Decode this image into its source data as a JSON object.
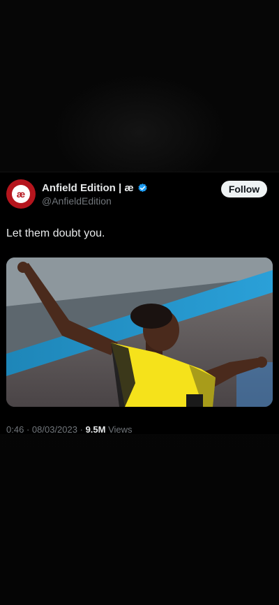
{
  "tweet": {
    "author": {
      "display_name": "Anfield Edition | æ",
      "handle": "@AnfieldEdition",
      "avatar_text": "æ",
      "verified": true,
      "avatar_color": "#b5151d"
    },
    "follow_label": "Follow",
    "text": "Let them doubt you.",
    "media": {
      "description_icon": "photo",
      "jersey_color": "#f5e21b"
    },
    "meta": {
      "time": "0:46",
      "separator": "·",
      "date": "08/03/2023",
      "views_count": "9.5M",
      "views_label": "Views"
    }
  },
  "colors": {
    "background": "#050505",
    "verified_blue": "#1d9bf0",
    "secondary_text": "#71767b"
  }
}
